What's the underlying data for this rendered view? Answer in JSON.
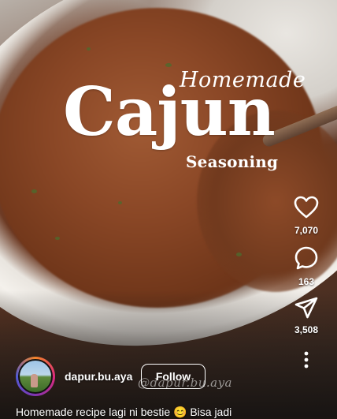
{
  "post": {
    "title_script": "Homemade",
    "title_main": "Cajun",
    "title_sub": "Seasoning",
    "watermark": "@dapur.bu.aya"
  },
  "actions": {
    "like_count": "7,070",
    "comment_count": "163",
    "share_count": "3,508",
    "icons": [
      "heart-icon",
      "comment-icon",
      "share-icon",
      "more-icon"
    ]
  },
  "author": {
    "username": "dapur.bu.aya",
    "follow_label": "Follow"
  },
  "caption": "Homemade recipe lagi ni bestie 😊 Bisa jadi",
  "colors": {
    "text": "#ffffff"
  }
}
